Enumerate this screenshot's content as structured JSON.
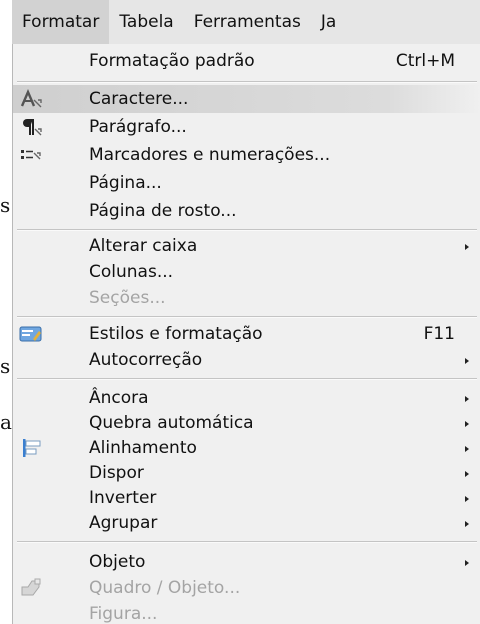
{
  "document": {
    "fragment_1": "s",
    "fragment_2": "s",
    "fragment_3": "a"
  },
  "menubar": {
    "formatar": "Formatar",
    "tabela": "Tabela",
    "ferramentas": "Ferramentas",
    "janela_partial": "Ja"
  },
  "menu": {
    "formatacao_padrao": {
      "label": "Formatação padrão",
      "shortcut": "Ctrl+M"
    },
    "caractere": "Caractere...",
    "paragrafo": "Parágrafo...",
    "marcadores": "Marcadores e numerações...",
    "pagina": "Página...",
    "pagina_rosto": "Página de rosto...",
    "alterar_caixa": "Alterar caixa",
    "colunas": "Colunas...",
    "secoes": "Seções...",
    "estilos": {
      "label": "Estilos e formatação",
      "shortcut": "F11"
    },
    "autocorrecao": "Autocorreção",
    "ancora": "Âncora",
    "quebra": "Quebra automática",
    "alinhamento": "Alinhamento",
    "dispor": "Dispor",
    "inverter": "Inverter",
    "agrupar": "Agrupar",
    "objeto": "Objeto",
    "quadro_objeto": "Quadro / Objeto...",
    "figura": "Figura..."
  }
}
